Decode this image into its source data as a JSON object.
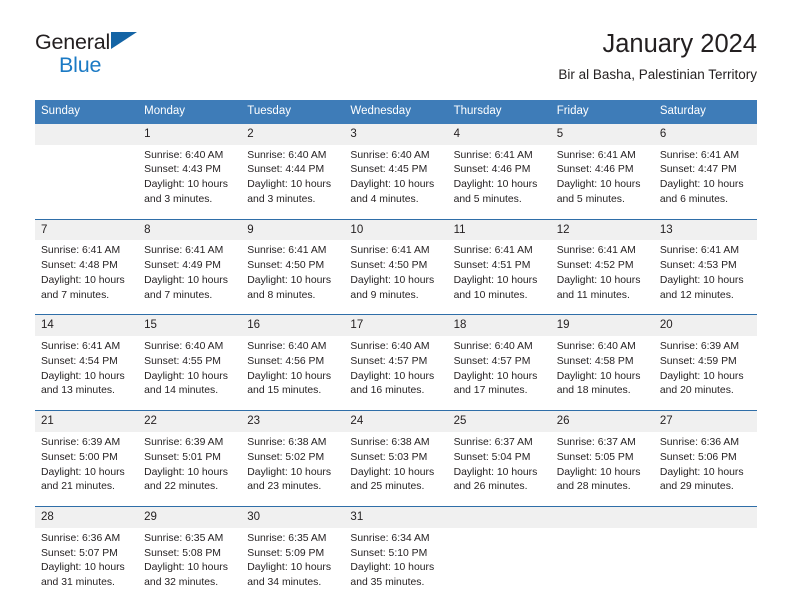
{
  "logo": {
    "word_one": "General",
    "word_two": "Blue",
    "triangle_icon": "triangle-icon",
    "brand_color": "#1b7ac4",
    "triangle_color": "#1464a5"
  },
  "header": {
    "title": "January 2024",
    "subtitle": "Bir al Basha, Palestinian Territory"
  },
  "theme": {
    "header_blue": "#3e7cb8",
    "week_rule": "#2f6ea8",
    "numrow_gray": "#f0f0f0",
    "text": "#231f20"
  },
  "weekday_headers": [
    "Sunday",
    "Monday",
    "Tuesday",
    "Wednesday",
    "Thursday",
    "Friday",
    "Saturday"
  ],
  "labels": {
    "sunrise_prefix": "Sunrise:",
    "sunset_prefix": "Sunset:",
    "daylight_prefix": "Daylight:"
  },
  "weeks": [
    {
      "numbers": [
        "",
        "1",
        "2",
        "3",
        "4",
        "5",
        "6"
      ],
      "cells": [
        {
          "empty": true
        },
        {
          "sunrise": "Sunrise: 6:40 AM",
          "sunset": "Sunset: 4:43 PM",
          "daylight_a": "Daylight: 10 hours",
          "daylight_b": "and 3 minutes."
        },
        {
          "sunrise": "Sunrise: 6:40 AM",
          "sunset": "Sunset: 4:44 PM",
          "daylight_a": "Daylight: 10 hours",
          "daylight_b": "and 3 minutes."
        },
        {
          "sunrise": "Sunrise: 6:40 AM",
          "sunset": "Sunset: 4:45 PM",
          "daylight_a": "Daylight: 10 hours",
          "daylight_b": "and 4 minutes."
        },
        {
          "sunrise": "Sunrise: 6:41 AM",
          "sunset": "Sunset: 4:46 PM",
          "daylight_a": "Daylight: 10 hours",
          "daylight_b": "and 5 minutes."
        },
        {
          "sunrise": "Sunrise: 6:41 AM",
          "sunset": "Sunset: 4:46 PM",
          "daylight_a": "Daylight: 10 hours",
          "daylight_b": "and 5 minutes."
        },
        {
          "sunrise": "Sunrise: 6:41 AM",
          "sunset": "Sunset: 4:47 PM",
          "daylight_a": "Daylight: 10 hours",
          "daylight_b": "and 6 minutes."
        }
      ]
    },
    {
      "numbers": [
        "7",
        "8",
        "9",
        "10",
        "11",
        "12",
        "13"
      ],
      "cells": [
        {
          "sunrise": "Sunrise: 6:41 AM",
          "sunset": "Sunset: 4:48 PM",
          "daylight_a": "Daylight: 10 hours",
          "daylight_b": "and 7 minutes."
        },
        {
          "sunrise": "Sunrise: 6:41 AM",
          "sunset": "Sunset: 4:49 PM",
          "daylight_a": "Daylight: 10 hours",
          "daylight_b": "and 7 minutes."
        },
        {
          "sunrise": "Sunrise: 6:41 AM",
          "sunset": "Sunset: 4:50 PM",
          "daylight_a": "Daylight: 10 hours",
          "daylight_b": "and 8 minutes."
        },
        {
          "sunrise": "Sunrise: 6:41 AM",
          "sunset": "Sunset: 4:50 PM",
          "daylight_a": "Daylight: 10 hours",
          "daylight_b": "and 9 minutes."
        },
        {
          "sunrise": "Sunrise: 6:41 AM",
          "sunset": "Sunset: 4:51 PM",
          "daylight_a": "Daylight: 10 hours",
          "daylight_b": "and 10 minutes."
        },
        {
          "sunrise": "Sunrise: 6:41 AM",
          "sunset": "Sunset: 4:52 PM",
          "daylight_a": "Daylight: 10 hours",
          "daylight_b": "and 11 minutes."
        },
        {
          "sunrise": "Sunrise: 6:41 AM",
          "sunset": "Sunset: 4:53 PM",
          "daylight_a": "Daylight: 10 hours",
          "daylight_b": "and 12 minutes."
        }
      ]
    },
    {
      "numbers": [
        "14",
        "15",
        "16",
        "17",
        "18",
        "19",
        "20"
      ],
      "cells": [
        {
          "sunrise": "Sunrise: 6:41 AM",
          "sunset": "Sunset: 4:54 PM",
          "daylight_a": "Daylight: 10 hours",
          "daylight_b": "and 13 minutes."
        },
        {
          "sunrise": "Sunrise: 6:40 AM",
          "sunset": "Sunset: 4:55 PM",
          "daylight_a": "Daylight: 10 hours",
          "daylight_b": "and 14 minutes."
        },
        {
          "sunrise": "Sunrise: 6:40 AM",
          "sunset": "Sunset: 4:56 PM",
          "daylight_a": "Daylight: 10 hours",
          "daylight_b": "and 15 minutes."
        },
        {
          "sunrise": "Sunrise: 6:40 AM",
          "sunset": "Sunset: 4:57 PM",
          "daylight_a": "Daylight: 10 hours",
          "daylight_b": "and 16 minutes."
        },
        {
          "sunrise": "Sunrise: 6:40 AM",
          "sunset": "Sunset: 4:57 PM",
          "daylight_a": "Daylight: 10 hours",
          "daylight_b": "and 17 minutes."
        },
        {
          "sunrise": "Sunrise: 6:40 AM",
          "sunset": "Sunset: 4:58 PM",
          "daylight_a": "Daylight: 10 hours",
          "daylight_b": "and 18 minutes."
        },
        {
          "sunrise": "Sunrise: 6:39 AM",
          "sunset": "Sunset: 4:59 PM",
          "daylight_a": "Daylight: 10 hours",
          "daylight_b": "and 20 minutes."
        }
      ]
    },
    {
      "numbers": [
        "21",
        "22",
        "23",
        "24",
        "25",
        "26",
        "27"
      ],
      "cells": [
        {
          "sunrise": "Sunrise: 6:39 AM",
          "sunset": "Sunset: 5:00 PM",
          "daylight_a": "Daylight: 10 hours",
          "daylight_b": "and 21 minutes."
        },
        {
          "sunrise": "Sunrise: 6:39 AM",
          "sunset": "Sunset: 5:01 PM",
          "daylight_a": "Daylight: 10 hours",
          "daylight_b": "and 22 minutes."
        },
        {
          "sunrise": "Sunrise: 6:38 AM",
          "sunset": "Sunset: 5:02 PM",
          "daylight_a": "Daylight: 10 hours",
          "daylight_b": "and 23 minutes."
        },
        {
          "sunrise": "Sunrise: 6:38 AM",
          "sunset": "Sunset: 5:03 PM",
          "daylight_a": "Daylight: 10 hours",
          "daylight_b": "and 25 minutes."
        },
        {
          "sunrise": "Sunrise: 6:37 AM",
          "sunset": "Sunset: 5:04 PM",
          "daylight_a": "Daylight: 10 hours",
          "daylight_b": "and 26 minutes."
        },
        {
          "sunrise": "Sunrise: 6:37 AM",
          "sunset": "Sunset: 5:05 PM",
          "daylight_a": "Daylight: 10 hours",
          "daylight_b": "and 28 minutes."
        },
        {
          "sunrise": "Sunrise: 6:36 AM",
          "sunset": "Sunset: 5:06 PM",
          "daylight_a": "Daylight: 10 hours",
          "daylight_b": "and 29 minutes."
        }
      ]
    },
    {
      "numbers": [
        "28",
        "29",
        "30",
        "31",
        "",
        "",
        ""
      ],
      "cells": [
        {
          "sunrise": "Sunrise: 6:36 AM",
          "sunset": "Sunset: 5:07 PM",
          "daylight_a": "Daylight: 10 hours",
          "daylight_b": "and 31 minutes."
        },
        {
          "sunrise": "Sunrise: 6:35 AM",
          "sunset": "Sunset: 5:08 PM",
          "daylight_a": "Daylight: 10 hours",
          "daylight_b": "and 32 minutes."
        },
        {
          "sunrise": "Sunrise: 6:35 AM",
          "sunset": "Sunset: 5:09 PM",
          "daylight_a": "Daylight: 10 hours",
          "daylight_b": "and 34 minutes."
        },
        {
          "sunrise": "Sunrise: 6:34 AM",
          "sunset": "Sunset: 5:10 PM",
          "daylight_a": "Daylight: 10 hours",
          "daylight_b": "and 35 minutes."
        },
        {
          "empty": true
        },
        {
          "empty": true
        },
        {
          "empty": true
        }
      ]
    }
  ]
}
